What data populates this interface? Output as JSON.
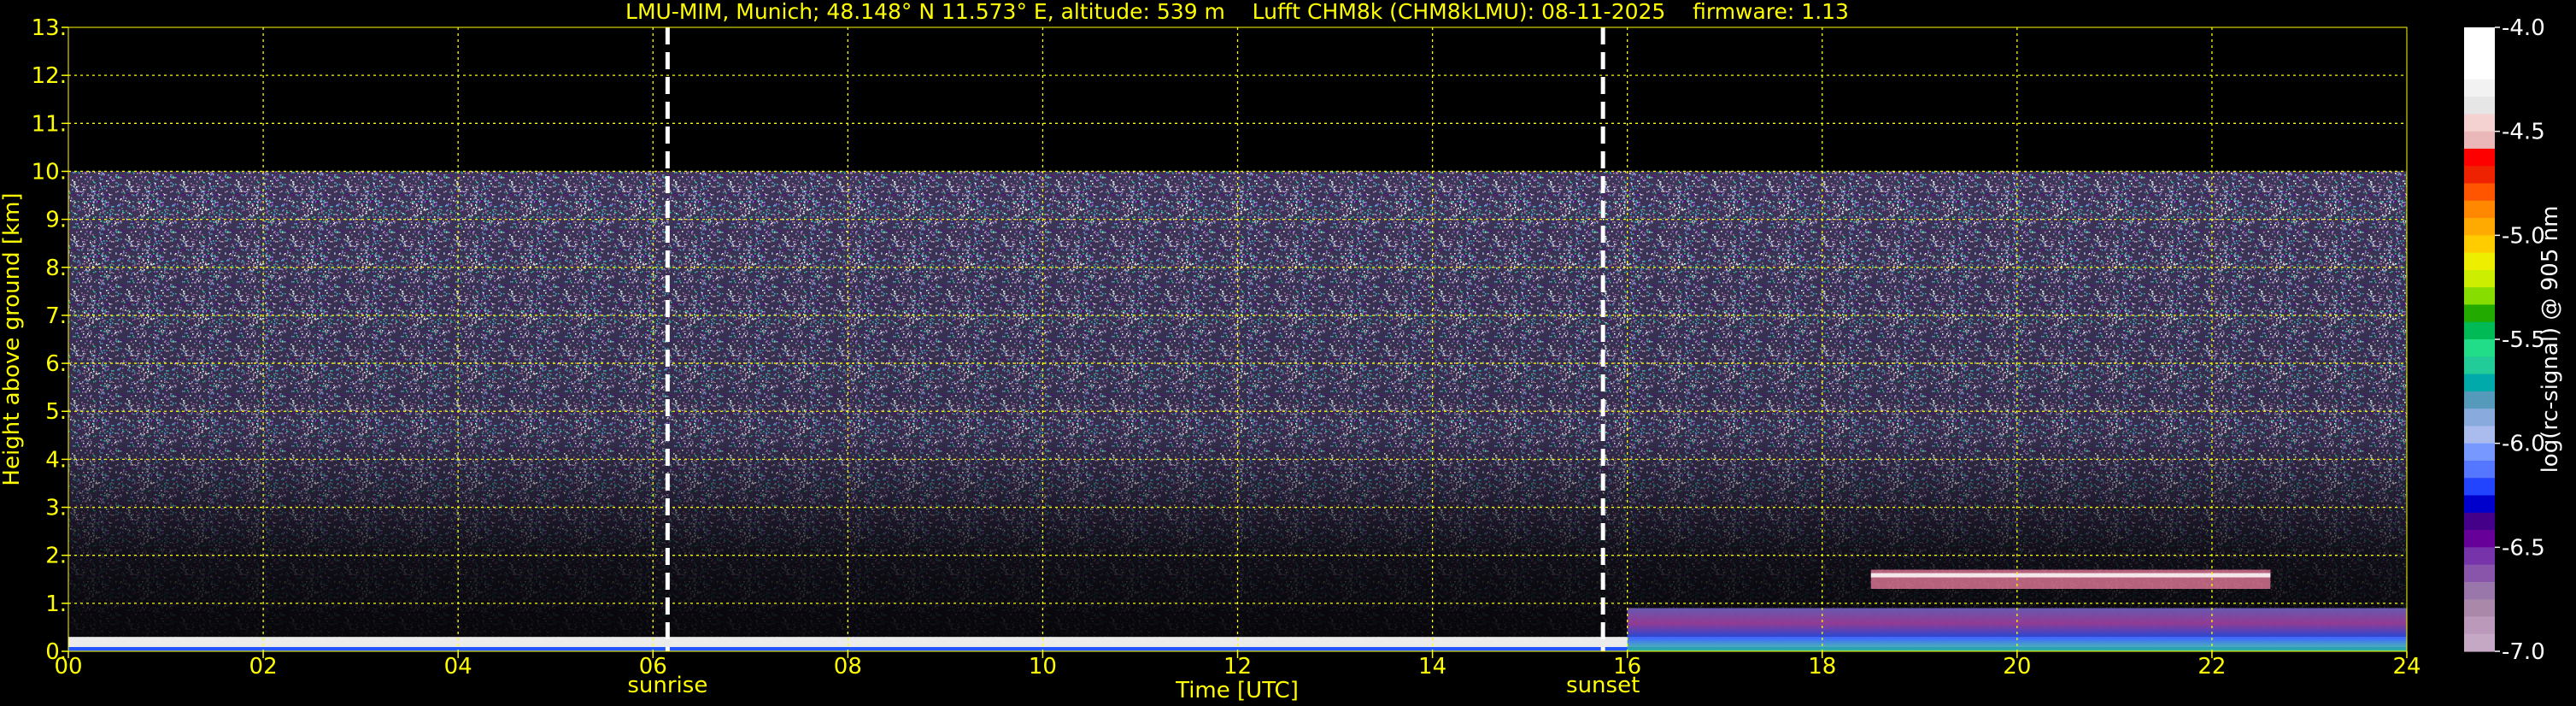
{
  "chart_data": {
    "type": "heatmap",
    "title": "LMU-MIM, Munich; 48.148° N 11.573° E, altitude: 539 m    Lufft CHM8k (CHM8kLMU): 08-11-2025    firmware: 1.13",
    "xlabel": "Time [UTC]",
    "ylabel": "Height above ground [km]",
    "xlim": [
      0,
      24
    ],
    "ylim": [
      0,
      13
    ],
    "xticks": [
      0,
      2,
      4,
      6,
      8,
      10,
      12,
      14,
      16,
      18,
      20,
      22,
      24
    ],
    "xtick_labels": [
      "00",
      "02",
      "04",
      "06",
      "08",
      "10",
      "12",
      "14",
      "16",
      "18",
      "20",
      "22",
      "24"
    ],
    "yticks": [
      0,
      1,
      2,
      3,
      4,
      5,
      6,
      7,
      8,
      9,
      10,
      11,
      12,
      13
    ],
    "ytick_labels": [
      "0.",
      "1.",
      "2.",
      "3.",
      "4.",
      "5.",
      "6.",
      "7.",
      "8.",
      "9.",
      "10.",
      "11.",
      "12.",
      "13."
    ],
    "grid": true,
    "data_top_km": 10,
    "markers": [
      {
        "label": "sunrise",
        "x": 6.15
      },
      {
        "label": "sunset",
        "x": 15.75
      }
    ],
    "features": [
      {
        "kind": "surface_layer",
        "x": [
          0,
          24
        ],
        "y": [
          0,
          0.3
        ]
      },
      {
        "kind": "cloud_layer",
        "x": [
          18.5,
          22.6
        ],
        "y": [
          1.3,
          1.7
        ]
      },
      {
        "kind": "boundary_layer",
        "x": [
          16,
          24
        ],
        "y": [
          0,
          0.9
        ]
      }
    ],
    "colorbar": {
      "label": "log(rc-signal) @ 905 nm",
      "range": [
        -7.0,
        -4.0
      ],
      "tick_values": [
        -4.0,
        -4.5,
        -5.0,
        -5.5,
        -6.0,
        -6.5,
        -7.0
      ],
      "tick_labels": [
        "-4.0",
        "-4.5",
        "-5.0",
        "-5.5",
        "-6.0",
        "-6.5",
        "-7.0"
      ],
      "colors": [
        "#ffffff",
        "#ffffff",
        "#ffffff",
        "#f2f2f2",
        "#e6e6e6",
        "#f4d2d2",
        "#eab8b8",
        "#ff0000",
        "#ee2200",
        "#ff5500",
        "#ff8800",
        "#ffaa00",
        "#ffcc00",
        "#eeee00",
        "#ccee00",
        "#88dd00",
        "#22aa00",
        "#00bb55",
        "#22dd88",
        "#22cc99",
        "#00aaaa",
        "#5599bb",
        "#88aadd",
        "#aabbee",
        "#7799ff",
        "#5577ff",
        "#2244ff",
        "#0000cc",
        "#440088",
        "#660099",
        "#7733aa",
        "#8855aa",
        "#9977aa",
        "#aa88aa",
        "#bb99bb",
        "#c4a8c4"
      ]
    },
    "colors": {
      "text": "#ffff00",
      "grid": "#ffff00",
      "colorbar_text": "#ffffff",
      "marker_line": "#ffffff",
      "background": "#000000"
    }
  }
}
